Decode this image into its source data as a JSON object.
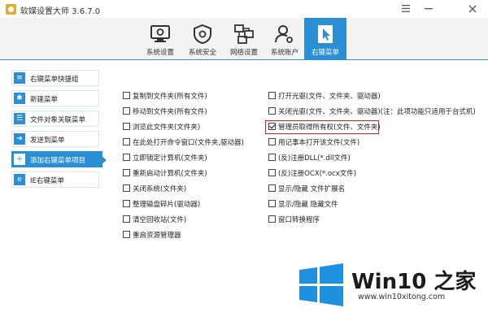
{
  "window": {
    "title": "软媒设置大师 3.6.7.0"
  },
  "toolbar": {
    "tabs": [
      {
        "label": "系统设置",
        "icon": "monitor-gear-icon"
      },
      {
        "label": "系统安全",
        "icon": "shield-gear-icon"
      },
      {
        "label": "网络设置",
        "icon": "network-icon"
      },
      {
        "label": "系统账户",
        "icon": "user-account-icon"
      },
      {
        "label": "右键菜单",
        "icon": "cursor-click-icon",
        "active": true
      }
    ]
  },
  "sidebar": {
    "items": [
      {
        "label": "右键菜单快捷组",
        "icon": "menu-list-icon"
      },
      {
        "label": "新建菜单",
        "icon": "new-menu-icon"
      },
      {
        "label": "文件对象关联菜单",
        "icon": "file-list-icon"
      },
      {
        "label": "发送到菜单",
        "icon": "send-to-icon"
      },
      {
        "label": "添加右键菜单项目",
        "icon": "add-item-icon",
        "active": true
      },
      {
        "label": "IE右键菜单",
        "icon": "ie-icon"
      }
    ]
  },
  "options": {
    "left": [
      {
        "label": "复制到文件夹(所有文件)",
        "checked": false
      },
      {
        "label": "移动到文件夹(所有文件)",
        "checked": false
      },
      {
        "label": "浏览此文件夹(文件夹)",
        "checked": false
      },
      {
        "label": "在此处打开命令窗口(文件夹,驱动器)",
        "checked": false
      },
      {
        "label": "立即锁定计算机(文件夹)",
        "checked": false
      },
      {
        "label": "重新启动计算机(文件夹)",
        "checked": false
      },
      {
        "label": "关闭系统(文件夹)",
        "checked": false
      },
      {
        "label": "整理磁盘碎片(驱动器)",
        "checked": false
      },
      {
        "label": "清空回收站(文件)",
        "checked": false
      },
      {
        "label": "重启资源管理器",
        "checked": false
      }
    ],
    "right": [
      {
        "label": "打开光驱(文件、文件夹、驱动器)",
        "checked": false
      },
      {
        "label": "关闭光驱(文件、文件夹、驱动器)(注：此项功能只适用于台式机)",
        "checked": false
      },
      {
        "label": "管理员取得所有权(文件、文件夹)",
        "checked": true
      },
      {
        "label": "用记事本打开该文件(文件)",
        "checked": false
      },
      {
        "label": "(反)注册DLL(*.dll文件)",
        "checked": false
      },
      {
        "label": "(反)注册OCX(*.ocx文件)",
        "checked": false
      },
      {
        "label": "显示/隐藏 文件扩展名",
        "checked": false
      },
      {
        "label": "显示/隐藏 隐藏文件",
        "checked": false
      },
      {
        "label": "窗口转换程序",
        "checked": false
      }
    ]
  },
  "watermark": {
    "brand": "Win10 之家",
    "url": "www.win10xitong.com",
    "logo_color": "#1e90e0"
  },
  "colors": {
    "accent": "#2b8fd6",
    "highlight": "#e02020"
  }
}
